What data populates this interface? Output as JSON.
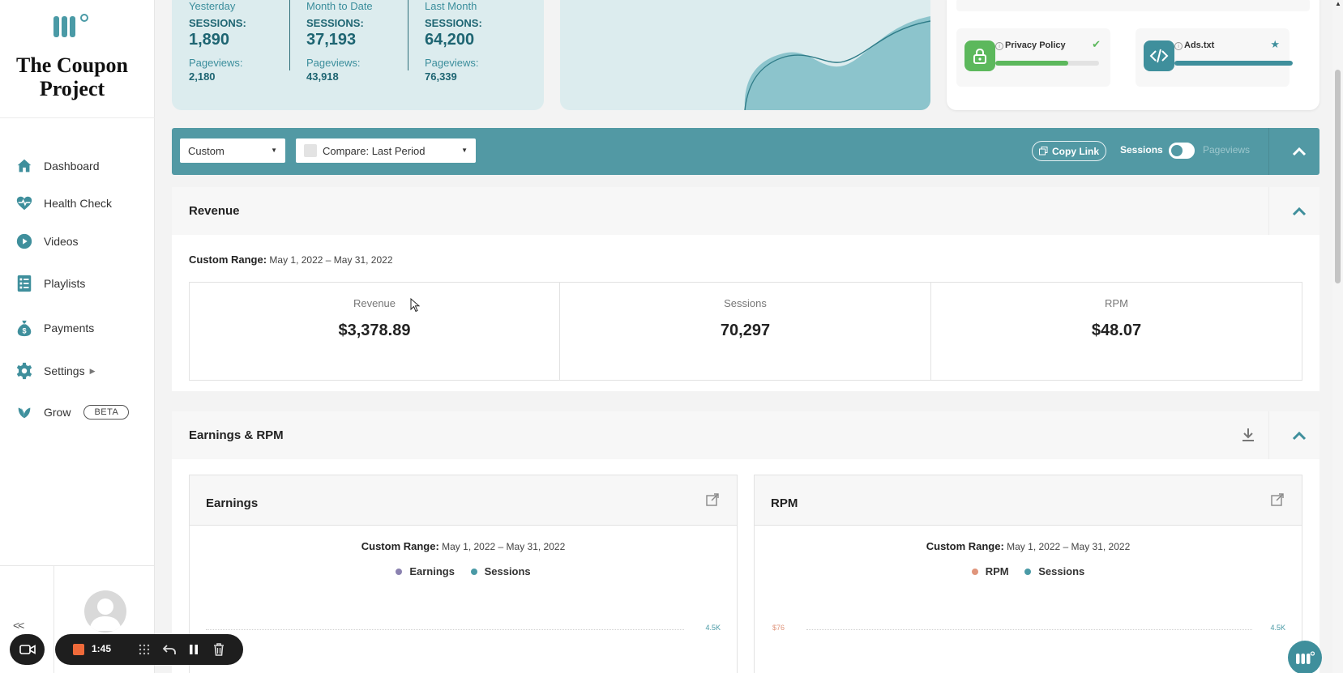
{
  "brand": {
    "site_title": "The Coupon Project",
    "accent": "#5299a4",
    "accent_light": "#dcecee"
  },
  "sidebar": {
    "items": [
      {
        "label": "Dashboard",
        "icon": "home-icon"
      },
      {
        "label": "Health Check",
        "icon": "heart-pulse-icon"
      },
      {
        "label": "Videos",
        "icon": "play-circle-icon"
      },
      {
        "label": "Playlists",
        "icon": "list-icon"
      },
      {
        "label": "Payments",
        "icon": "money-bag-icon"
      },
      {
        "label": "Settings",
        "icon": "gear-icon"
      },
      {
        "label": "Grow",
        "icon": "leaf-icon",
        "badge": "BETA"
      }
    ],
    "collapse_label": "<<"
  },
  "stats": [
    {
      "period": "Yesterday",
      "sessions_label": "SESSIONS:",
      "sessions": "1,890",
      "pageviews_label": "Pageviews:",
      "pageviews": "2,180"
    },
    {
      "period": "Month to Date",
      "sessions_label": "SESSIONS:",
      "sessions": "37,193",
      "pageviews_label": "Pageviews:",
      "pageviews": "43,918"
    },
    {
      "period": "Last Month",
      "sessions_label": "SESSIONS:",
      "sessions": "64,200",
      "pageviews_label": "Pageviews:",
      "pageviews": "76,339"
    }
  ],
  "health": {
    "checks": [
      {
        "name": "Privacy Policy",
        "icon": "lock-icon",
        "status_icon": "check-icon",
        "progress": 0.7,
        "color": "#5cb85c"
      },
      {
        "name": "Ads.txt",
        "icon": "code-icon",
        "status_icon": "star-icon",
        "progress": 1.0,
        "color": "#3f8f9c"
      }
    ]
  },
  "filters": {
    "range_select": "Custom",
    "compare_select": "Compare: Last Period",
    "copy_link": "Copy Link",
    "toggle_on_label": "Sessions",
    "toggle_off_label": "Pageviews"
  },
  "revenue": {
    "title": "Revenue",
    "range_label": "Custom Range:",
    "range_value": "May 1, 2022 – May 31, 2022",
    "metrics": [
      {
        "label": "Revenue",
        "value": "$3,378.89"
      },
      {
        "label": "Sessions",
        "value": "70,297"
      },
      {
        "label": "RPM",
        "value": "$48.07"
      }
    ]
  },
  "earnings_rpm": {
    "title": "Earnings & RPM",
    "cards": [
      {
        "title": "Earnings",
        "range_label": "Custom Range:",
        "range_value": "May 1, 2022 – May 31, 2022",
        "legend": [
          {
            "name": "Earnings",
            "color": "#8b82b0"
          },
          {
            "name": "Sessions",
            "color": "#4a9aa6"
          }
        ],
        "left_tick": "",
        "right_tick": "4.5K"
      },
      {
        "title": "RPM",
        "range_label": "Custom Range:",
        "range_value": "May 1, 2022 – May 31, 2022",
        "legend": [
          {
            "name": "RPM",
            "color": "#e0957c"
          },
          {
            "name": "Sessions",
            "color": "#4a9aa6"
          }
        ],
        "left_tick": "$76",
        "right_tick": "4.5K"
      }
    ]
  },
  "recorder": {
    "time": "1:45"
  }
}
